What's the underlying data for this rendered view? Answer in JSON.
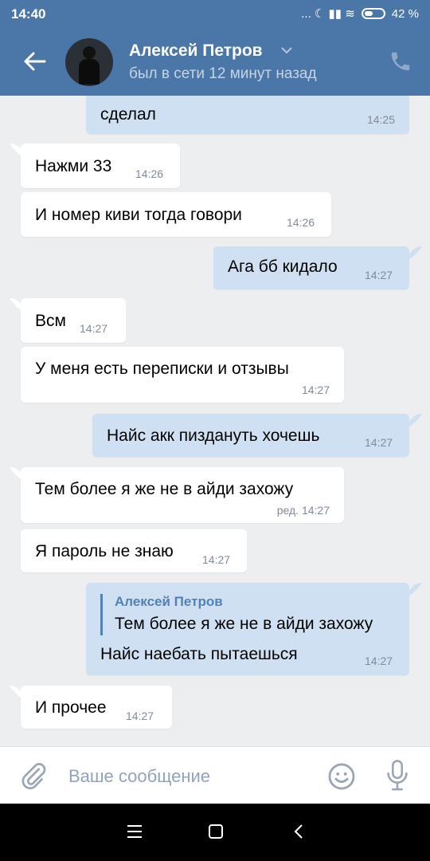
{
  "status": {
    "time": "14:40",
    "icons": "... ☾ ▮▮ ≋",
    "battery": "42 %"
  },
  "header": {
    "name": "Алексей Петров",
    "last_seen": "был в сети 12 минут назад"
  },
  "messages": [
    {
      "dir": "out",
      "text": "сделал",
      "time": "14:25"
    },
    {
      "dir": "in",
      "text": "Нажми 33",
      "time": "14:26"
    },
    {
      "dir": "in",
      "text": "И номер киви тогда говори",
      "time": "14:26"
    },
    {
      "dir": "out",
      "text": "Ага бб кидало",
      "time": "14:27"
    },
    {
      "dir": "in",
      "text": "Всм",
      "time": "14:27"
    },
    {
      "dir": "in",
      "text": "У меня есть переписки и отзывы",
      "time": "14:27"
    },
    {
      "dir": "out",
      "text": "Найс акк пиздануть хочешь",
      "time": "14:27"
    },
    {
      "dir": "in",
      "text": "Тем более я же не в айди захожу",
      "time": "ред. 14:27"
    },
    {
      "dir": "in",
      "text": "Я пароль не знаю",
      "time": "14:27"
    },
    {
      "dir": "out",
      "reply_name": "Алексей Петров",
      "reply_text": "Тем более я же не в айди захожу",
      "text": "Найс наебать пытаешься",
      "time": "14:27"
    },
    {
      "dir": "in",
      "text": "И прочее",
      "time": "14:27"
    }
  ],
  "composer": {
    "placeholder": "Ваше сообщение"
  },
  "colors": {
    "header": "#4a76a8",
    "outgoing": "#cfe0f3",
    "incoming": "#ffffff",
    "background": "#edeef0"
  }
}
